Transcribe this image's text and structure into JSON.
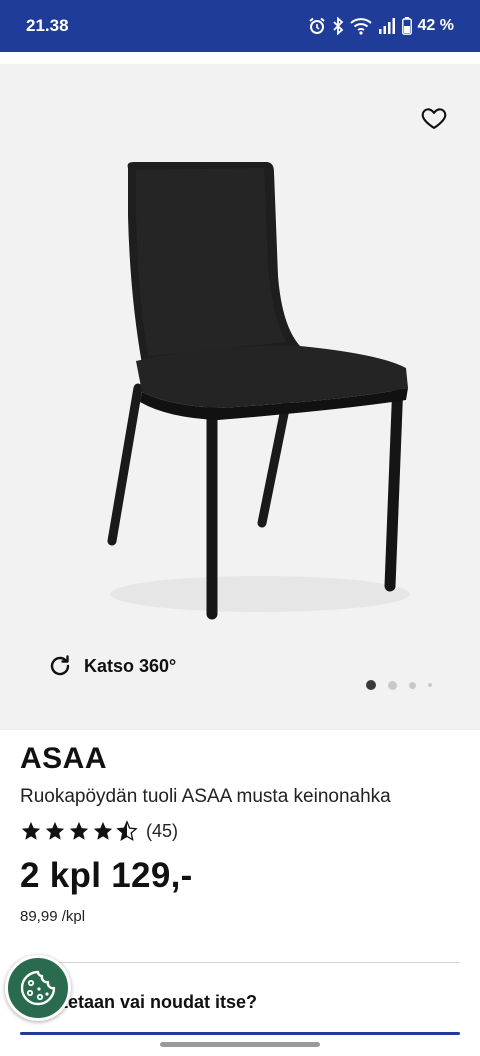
{
  "status_bar": {
    "time": "21.38",
    "battery": "42 %",
    "icons": [
      "alarm-icon",
      "bluetooth-icon",
      "wifi-icon",
      "signal-icon",
      "battery-icon"
    ],
    "background": "#1f3c99"
  },
  "gallery": {
    "view360_label": "Katso 360°",
    "image_count": 4,
    "active_image": 1,
    "favorite_icon": "heart-outline-icon"
  },
  "product": {
    "brand": "ASAA",
    "subtitle": "Ruokapöydän tuoli ASAA musta keinonahka",
    "rating": 4.5,
    "rating_max": 5,
    "review_count": "(45)",
    "price": "2 kpl 129,-",
    "unit_price": "89,99 /kpl"
  },
  "delivery": {
    "question": "litetaan vai noudat itse?"
  },
  "cookie_button": {
    "icon": "cookie-icon",
    "color": "#2a6b4f"
  }
}
